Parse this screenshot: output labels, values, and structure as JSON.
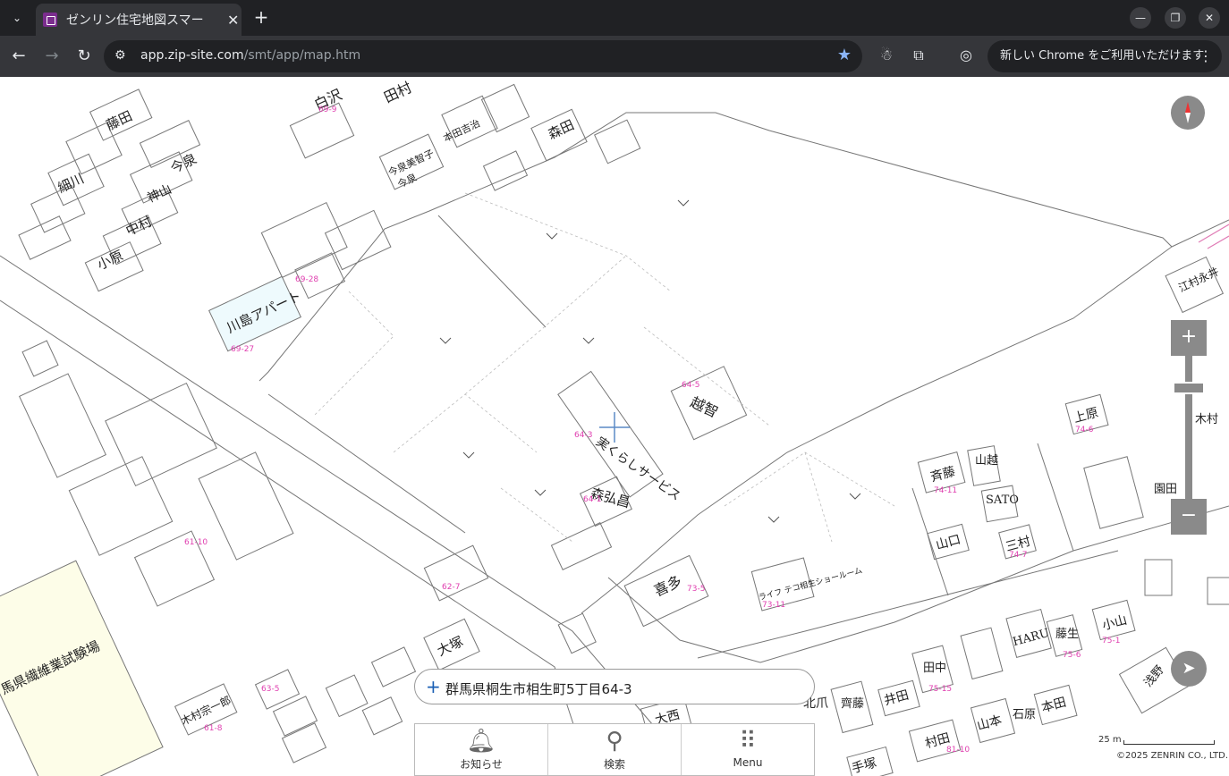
{
  "browser": {
    "tab_title": "ゼンリン住宅地図スマー",
    "url_host": "app.zip-site.com",
    "url_path": "/smt/app/map.htm",
    "profile_message": "新しい Chrome をご利用いただけます",
    "colors": {
      "frame": "#202124",
      "toolbar": "#35363a",
      "accent": "#8ab4f8"
    }
  },
  "map": {
    "address": "群馬県桐生市相生町5丁目64-3",
    "scale_label": "25 m",
    "copyright": "©2025 ZENRIN CO., LTD.",
    "labels": [
      {
        "text": "白沢",
        "cls": "big"
      },
      {
        "text": "田村",
        "cls": "big"
      },
      {
        "text": "森田",
        "cls": "big"
      },
      {
        "text": "藤田",
        "cls": "big"
      },
      {
        "text": "今泉",
        "cls": "big"
      },
      {
        "text": "細川",
        "cls": "big"
      },
      {
        "text": "神山",
        "cls": "big"
      },
      {
        "text": "中村",
        "cls": "big"
      },
      {
        "text": "小原",
        "cls": "big"
      },
      {
        "text": "本田吉治",
        "cls": "small"
      },
      {
        "text": "今泉美智子",
        "cls": "small"
      },
      {
        "text": "今泉",
        "cls": "small"
      },
      {
        "text": "川島アパート",
        "cls": "big"
      },
      {
        "text": "越智",
        "cls": "big"
      },
      {
        "text": "実くらしサービス",
        "cls": "big"
      },
      {
        "text": "森弘昌",
        "cls": "big"
      },
      {
        "text": "喜多",
        "cls": "big"
      },
      {
        "text": "大塚",
        "cls": "big"
      },
      {
        "text": "斉藤",
        "cls": "big"
      },
      {
        "text": "山越",
        "cls": "big"
      },
      {
        "text": "SATO",
        "cls": "big"
      },
      {
        "text": "山口",
        "cls": "big"
      },
      {
        "text": "三村",
        "cls": "big"
      },
      {
        "text": "上原",
        "cls": "big"
      },
      {
        "text": "江村永井",
        "cls": "big"
      },
      {
        "text": "HARU",
        "cls": "big"
      },
      {
        "text": "藤生",
        "cls": "big"
      },
      {
        "text": "小山",
        "cls": "big"
      },
      {
        "text": "田中",
        "cls": "big"
      },
      {
        "text": "井田",
        "cls": "big"
      },
      {
        "text": "本田",
        "cls": "big"
      },
      {
        "text": "村田",
        "cls": "big"
      },
      {
        "text": "山本",
        "cls": "big"
      },
      {
        "text": "石原",
        "cls": "big"
      },
      {
        "text": "齊藤",
        "cls": "big"
      },
      {
        "text": "手塚",
        "cls": "big"
      },
      {
        "text": "木村宗一郎",
        "cls": "big"
      },
      {
        "text": "大西",
        "cls": "big"
      },
      {
        "text": "北爪",
        "cls": "big"
      },
      {
        "text": "園田",
        "cls": "big"
      },
      {
        "text": "浅野",
        "cls": "big"
      },
      {
        "text": "木村",
        "cls": "big"
      },
      {
        "text": "馬県繊維業試験場",
        "cls": "big"
      },
      {
        "text": "ライフ テコ相生ショールーム",
        "cls": "small"
      }
    ],
    "numbers": [
      "69-9",
      "64-5",
      "64-3",
      "64-1",
      "73-5",
      "73-11",
      "74-11",
      "74-7",
      "74-6",
      "61-10",
      "62-7",
      "63-5",
      "61-8",
      "69-27",
      "69-28",
      "75-15",
      "75-1",
      "75-6",
      "81-10"
    ]
  },
  "controls": {
    "zoom_in": "+",
    "zoom_out": "−"
  },
  "menu": [
    {
      "label": "お知らせ",
      "icon": "bell-icon"
    },
    {
      "label": "検索",
      "icon": "search-icon"
    },
    {
      "label": "Menu",
      "icon": "grid-icon"
    }
  ]
}
